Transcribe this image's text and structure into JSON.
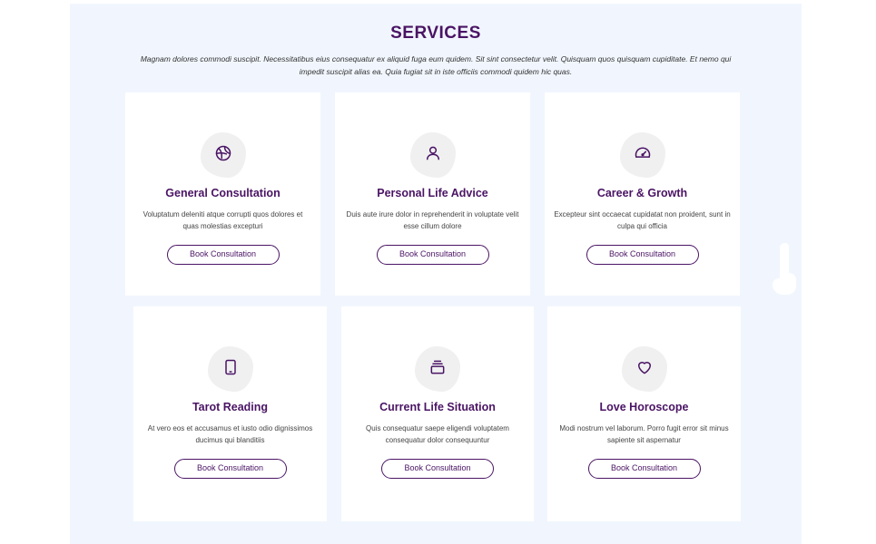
{
  "section": {
    "title": "SERVICES",
    "subtitle": "Magnam dolores commodi suscipit. Necessitatibus eius consequatur ex aliquid fuga eum quidem. Sit sint consectetur velit. Quisquam quos quisquam cupiditate. Et nemo qui impedit suscipit alias ea. Quia fugiat sit in iste officiis commodi quidem hic quas."
  },
  "colors": {
    "accent": "#4a1464",
    "panel_bg": "#f1f6fe",
    "card_bg": "#ffffff",
    "icon_blob": "#f0f0f1"
  },
  "cards": [
    {
      "title": "General Consultation",
      "description": "Voluptatum deleniti atque corrupti quos dolores et quas molestias excepturi",
      "button": "Book Consultation",
      "icon": "basketball-icon"
    },
    {
      "title": "Personal Life Advice",
      "description": "Duis aute irure dolor in reprehenderit in voluptate velit esse cillum dolore",
      "button": "Book Consultation",
      "icon": "person-icon"
    },
    {
      "title": "Career & Growth",
      "description": "Excepteur sint occaecat cupidatat non proident, sunt in culpa qui officia",
      "button": "Book Consultation",
      "icon": "speedometer-icon"
    },
    {
      "title": "Tarot Reading",
      "description": "At vero eos et accusamus et iusto odio dignissimos ducimus qui blanditiis",
      "button": "Book Consultation",
      "icon": "tablet-icon"
    },
    {
      "title": "Current Life Situation",
      "description": "Quis consequatur saepe eligendi voluptatem consequatur dolor consequuntur",
      "button": "Book Consultation",
      "icon": "stack-icon"
    },
    {
      "title": "Love Horoscope",
      "description": "Modi nostrum vel laborum. Porro fugit error sit minus sapiente sit aspernatur",
      "button": "Book Consultation",
      "icon": "heart-icon"
    }
  ]
}
